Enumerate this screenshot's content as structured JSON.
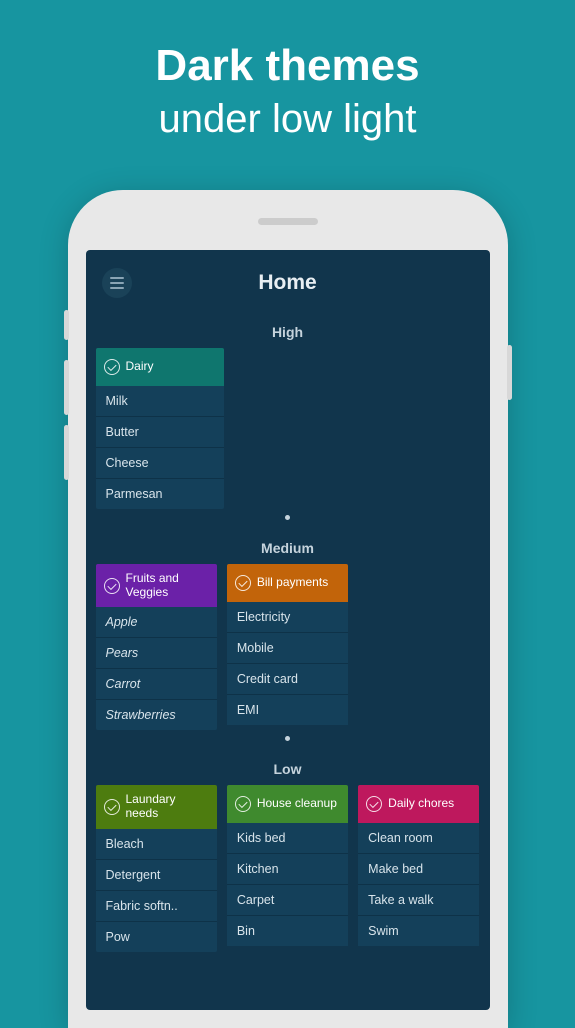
{
  "promo": {
    "line1": "Dark themes",
    "line2": "under low light"
  },
  "app": {
    "title": "Home"
  },
  "sections": {
    "high": {
      "label": "High",
      "cards": [
        {
          "title": "Dairy",
          "color": "teal",
          "items": [
            "Milk",
            "Butter",
            "Cheese",
            "Parmesan"
          ]
        }
      ]
    },
    "medium": {
      "label": "Medium",
      "cards": [
        {
          "title": "Fruits and Veggies",
          "color": "purple",
          "italic": true,
          "items": [
            "Apple",
            "Pears",
            "Carrot",
            "Strawberries"
          ]
        },
        {
          "title": "Bill payments",
          "color": "orange",
          "items": [
            "Electricity",
            "Mobile",
            "Credit card",
            "EMI"
          ]
        }
      ]
    },
    "low": {
      "label": "Low",
      "cards": [
        {
          "title": "Laundary needs",
          "color": "olive",
          "items": [
            "Bleach",
            "Detergent",
            "Fabric softn..",
            "Pow"
          ]
        },
        {
          "title": "House cleanup",
          "color": "green",
          "items": [
            "Kids bed",
            "Kitchen",
            "Carpet",
            "Bin"
          ]
        },
        {
          "title": "Daily chores",
          "color": "pink",
          "items": [
            "Clean room",
            "Make bed",
            "Take a walk",
            "Swim"
          ]
        }
      ]
    }
  }
}
